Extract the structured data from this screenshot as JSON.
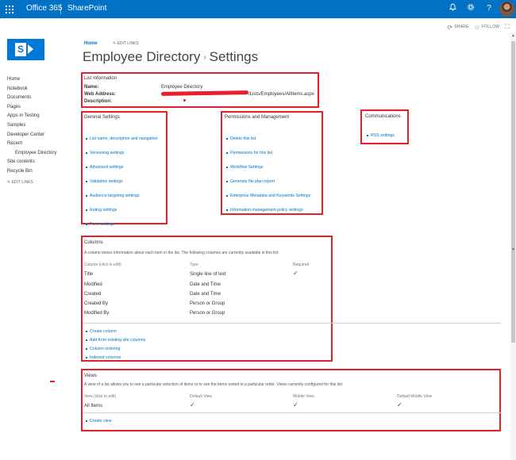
{
  "suitebar": {
    "office365": "Office 365",
    "app": "SharePoint",
    "bell_icon": "bell-icon",
    "gear_icon": "gear-icon",
    "help": "?"
  },
  "actions": {
    "share": "SHARE",
    "follow": "FOLLOW"
  },
  "breadcrumb": {
    "home": "Home",
    "edit_links": "EDIT LINKS"
  },
  "title": {
    "list": "Employee Directory",
    "separator": "›",
    "page": "Settings"
  },
  "leftnav": {
    "items": [
      {
        "label": "Home",
        "sub": false
      },
      {
        "label": "Notebook",
        "sub": false
      },
      {
        "label": "Documents",
        "sub": false
      },
      {
        "label": "Pages",
        "sub": false
      },
      {
        "label": "Apps in Testing",
        "sub": false
      },
      {
        "label": "Samples",
        "sub": false
      },
      {
        "label": "Developer Center",
        "sub": false
      },
      {
        "label": "Recent",
        "sub": false
      },
      {
        "label": "Employee Directory",
        "sub": true
      },
      {
        "label": "Site contents",
        "sub": false
      },
      {
        "label": "Recycle Bin",
        "sub": false
      }
    ],
    "edit_links": "EDIT LINKS"
  },
  "list_info": {
    "heading": "List Information",
    "name_label": "Name:",
    "name_value": "Employee Directory",
    "web_label": "Web Address:",
    "web_value": "/Lists/Employees/AllItems.aspx",
    "desc_label": "Description:"
  },
  "general": {
    "heading": "General Settings",
    "links": [
      "List name, description and navigation",
      "Versioning settings",
      "Advanced settings",
      "Validation settings",
      "Audience targeting settings",
      "Rating settings",
      "Form settings"
    ]
  },
  "permissions": {
    "heading": "Permissions and Management",
    "links": [
      "Delete this list",
      "Permissions for this list",
      "Workflow Settings",
      "Generate file plan report",
      "Enterprise Metadata and Keywords Settings",
      "Information management policy settings"
    ]
  },
  "communications": {
    "heading": "Communications",
    "links": [
      "RSS settings"
    ]
  },
  "columns": {
    "heading": "Columns",
    "description": "A column stores information about each item in the list. The following columns are currently available in this list:",
    "headers": [
      "Column (click to edit)",
      "Type",
      "Required"
    ],
    "rows": [
      {
        "name": "Title",
        "type": "Single line of text",
        "required": true
      },
      {
        "name": "Modified",
        "type": "Date and Time",
        "required": false
      },
      {
        "name": "Created",
        "type": "Date and Time",
        "required": false
      },
      {
        "name": "Created By",
        "type": "Person or Group",
        "required": false
      },
      {
        "name": "Modified By",
        "type": "Person or Group",
        "required": false
      }
    ],
    "links": [
      "Create column",
      "Add from existing site columns",
      "Column ordering",
      "Indexed columns"
    ]
  },
  "views": {
    "heading": "Views",
    "description": "A view of a list allows you to see a particular selection of items or to see the items sorted in a particular order. Views currently configured for this list:",
    "headers": [
      "View (click to edit)",
      "Default View",
      "Mobile View",
      "Default Mobile View"
    ],
    "rows": [
      {
        "name": "All Items",
        "default": true,
        "mobile": true,
        "default_mobile": true
      }
    ],
    "links": [
      "Create view"
    ]
  },
  "colors": {
    "suitebar": "#0072c6",
    "link": "#0072c6",
    "annotation": "#e8202a"
  }
}
